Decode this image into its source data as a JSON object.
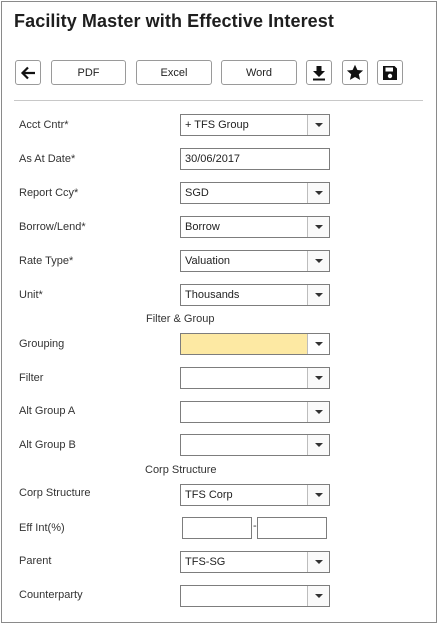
{
  "title": "Facility Master with Effective Interest",
  "toolbar": {
    "back_icon": "arrow-left-icon",
    "pdf_label": "PDF",
    "excel_label": "Excel",
    "word_label": "Word",
    "download_icon": "download-icon",
    "favorite_icon": "star-icon",
    "save_icon": "save-icon"
  },
  "fields": {
    "acct_cntr": {
      "label": "Acct Cntr*",
      "value": "+ TFS Group"
    },
    "as_at_date": {
      "label": "As At Date*",
      "value": "30/06/2017"
    },
    "report_ccy": {
      "label": "Report Ccy*",
      "value": "SGD"
    },
    "borrow_lend": {
      "label": "Borrow/Lend*",
      "value": "Borrow"
    },
    "rate_type": {
      "label": "Rate Type*",
      "value": "Valuation"
    },
    "unit": {
      "label": "Unit*",
      "value": "Thousands"
    }
  },
  "filter_group": {
    "title": "Filter & Group",
    "grouping": {
      "label": "Grouping",
      "value": ""
    },
    "filter": {
      "label": "Filter",
      "value": ""
    },
    "alt_group_a": {
      "label": "Alt Group A",
      "value": ""
    },
    "alt_group_b": {
      "label": "Alt Group B",
      "value": ""
    }
  },
  "corp_structure": {
    "title": "Corp Structure",
    "corp_structure": {
      "label": "Corp Structure",
      "value": "TFS Corp"
    },
    "eff_int": {
      "label": "Eff Int(%)",
      "from": "",
      "separator": "-",
      "to": ""
    },
    "parent": {
      "label": "Parent",
      "value": "TFS-SG"
    },
    "counterparty": {
      "label": "Counterparty",
      "value": ""
    }
  },
  "colors": {
    "highlight": "#fde9a3",
    "border": "#7d7d7d"
  }
}
